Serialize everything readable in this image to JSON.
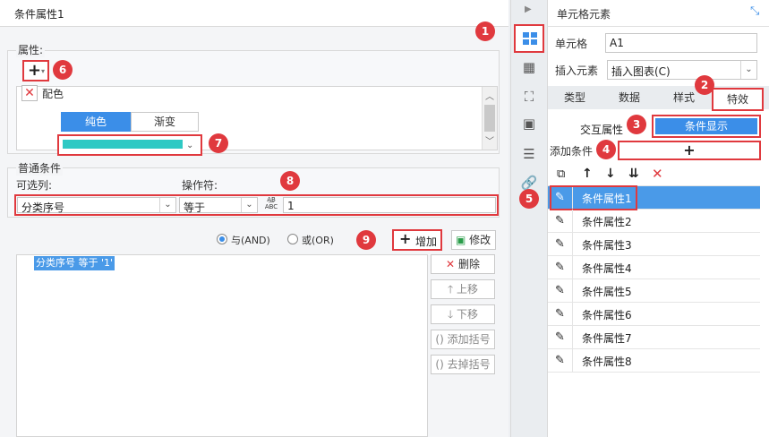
{
  "left": {
    "title": "条件属性1",
    "attr_label": "属性:",
    "add_glyph": "+",
    "attr_item": "配色",
    "color_tabs": [
      "纯色",
      "渐变"
    ],
    "color_value": "#2ec9c4",
    "general_label": "普通条件",
    "column_label": "可选列:",
    "operator_label": "操作符:",
    "column_value": "分类序号",
    "operator_value": "等于",
    "formula_icon_text": "ABC",
    "value_input": "1",
    "radio_and": "与(AND)",
    "radio_or": "或(OR)",
    "add_button": "增加",
    "modify_button": "修改",
    "condition_text": "分类序号 等于 '1'",
    "side_buttons": [
      "删除",
      "上移",
      "下移",
      "添加括号",
      "去掉括号"
    ]
  },
  "right": {
    "title": "单元格元素",
    "cell_label": "单元格",
    "cell_value": "A1",
    "insert_label": "插入元素",
    "insert_value": "插入图表(C)",
    "tabs": [
      "类型",
      "数据",
      "样式",
      "特效"
    ],
    "subtabs": [
      "交互属性",
      "条件显示"
    ],
    "add_condition_label": "添加条件",
    "add_condition_glyph": "+",
    "conditions": [
      "条件属性1",
      "条件属性2",
      "条件属性3",
      "条件属性4",
      "条件属性5",
      "条件属性6",
      "条件属性7",
      "条件属性8"
    ]
  },
  "badges": [
    "1",
    "2",
    "3",
    "4",
    "5",
    "6",
    "7",
    "8",
    "9"
  ],
  "colors": {
    "accent": "#3b8ee8",
    "highlight": "#e0393e",
    "selected": "#4a9ae8"
  }
}
